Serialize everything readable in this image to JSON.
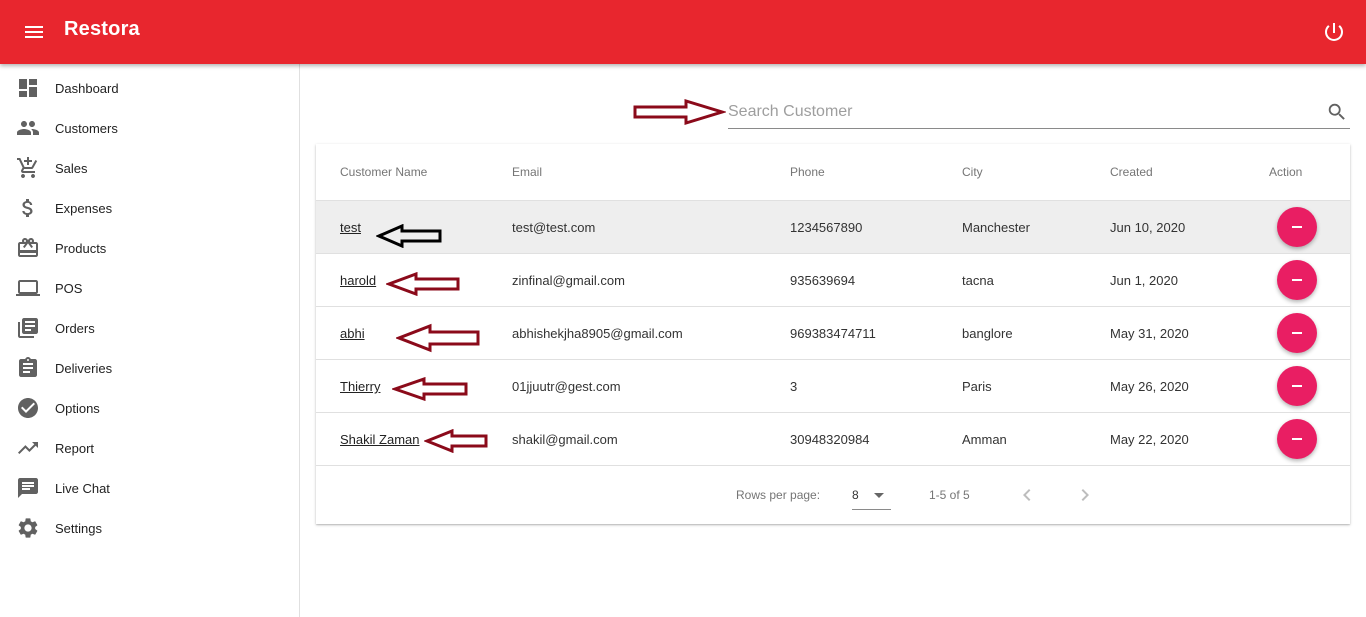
{
  "app": {
    "title": "Restora"
  },
  "header": {
    "menu_icon": "hamburger-menu-icon",
    "power_icon": "power-icon"
  },
  "sidebar": {
    "items": [
      {
        "label": "Dashboard",
        "icon": "dashboard-icon"
      },
      {
        "label": "Customers",
        "icon": "people-icon"
      },
      {
        "label": "Sales",
        "icon": "add-shopping-cart-icon"
      },
      {
        "label": "Expenses",
        "icon": "dollar-icon"
      },
      {
        "label": "Products",
        "icon": "gift-card-icon"
      },
      {
        "label": "POS",
        "icon": "laptop-icon"
      },
      {
        "label": "Orders",
        "icon": "library-books-icon"
      },
      {
        "label": "Deliveries",
        "icon": "clipboard-icon"
      },
      {
        "label": "Options",
        "icon": "check-circle-icon"
      },
      {
        "label": "Report",
        "icon": "trending-up-icon"
      },
      {
        "label": "Live Chat",
        "icon": "chat-icon"
      },
      {
        "label": "Settings",
        "icon": "gear-icon"
      }
    ]
  },
  "search": {
    "placeholder": "Search Customer",
    "value": ""
  },
  "table": {
    "columns": [
      "Customer Name",
      "Email",
      "Phone",
      "City",
      "Created",
      "Action"
    ],
    "rows": [
      {
        "name": "test",
        "email": "test@test.com",
        "phone": "1234567890",
        "city": "Manchester",
        "created": "Jun 10, 2020"
      },
      {
        "name": "harold",
        "email": "zinfinal@gmail.com",
        "phone": "935639694",
        "city": "tacna",
        "created": "Jun 1, 2020"
      },
      {
        "name": "abhi",
        "email": "abhishekjha8905@gmail.com",
        "phone": "969383474711",
        "city": "banglore",
        "created": "May 31, 2020"
      },
      {
        "name": "Thierry",
        "email": "01jjuutr@gest.com",
        "phone": "3",
        "city": "Paris",
        "created": "May 26, 2020"
      },
      {
        "name": "Shakil Zaman",
        "email": "shakil@gmail.com",
        "phone": "30948320984",
        "city": "Amman",
        "created": "May 22, 2020"
      }
    ]
  },
  "pagination": {
    "rows_per_page_label": "Rows per page:",
    "rows_per_page": "8",
    "range": "1-5 of 5"
  },
  "colors": {
    "appbar": "#e8262e",
    "delete_button": "#e91e63",
    "annotation_arrow": "#8b0a1a"
  }
}
